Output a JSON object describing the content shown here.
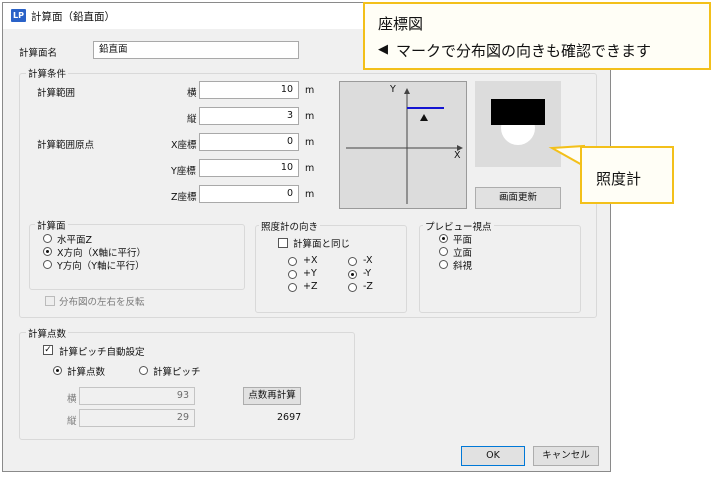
{
  "dialog": {
    "title": "計算面（鉛直面）",
    "app_icon": "LP"
  },
  "plane_name": {
    "label": "計算面名",
    "value": "鉛直面"
  },
  "calc_conditions": {
    "title": "計算条件",
    "range_label": "計算範囲",
    "width_label": "横",
    "width_value": "10",
    "width_unit": "m",
    "height_label": "縦",
    "height_value": "3",
    "height_unit": "m",
    "origin_label": "計算範囲原点",
    "x_label": "X座標",
    "x_value": "0",
    "x_unit": "m",
    "y_label": "Y座標",
    "y_value": "10",
    "y_unit": "m",
    "z_label": "Z座標",
    "z_value": "0",
    "z_unit": "m"
  },
  "coord_diagram": {
    "y_axis": "Y",
    "x_axis": "X"
  },
  "refresh_button": "画面更新",
  "plane_group": {
    "title": "計算面",
    "options": [
      "水平面Z",
      "X方向（X軸に平行）",
      "Y方向（Y軸に平行）"
    ],
    "selected_index": 1
  },
  "flip_checkbox": {
    "label": "分布図の左右を反転",
    "checked": false,
    "disabled": true
  },
  "meter_direction": {
    "title": "照度計の向き",
    "same_label": "計算面と同じ",
    "same_checked": false,
    "options_left": [
      "+X",
      "+Y",
      "+Z"
    ],
    "options_right": [
      "-X",
      "-Y",
      "-Z"
    ],
    "selected": "-Y"
  },
  "preview_view": {
    "title": "プレビュー視点",
    "options": [
      "平面",
      "立面",
      "斜視"
    ],
    "selected_index": 0
  },
  "points": {
    "title": "計算点数",
    "auto_pitch_label": "計算ピッチ自動設定",
    "auto_pitch_checked": true,
    "radio_count_label": "計算点数",
    "radio_pitch_label": "計算ピッチ",
    "selected": "count",
    "width_label": "横",
    "width_value": "93",
    "height_label": "縦",
    "height_value": "29",
    "recalc_button": "点数再計算",
    "total": "2697"
  },
  "buttons": {
    "ok": "OK",
    "cancel": "キャンセル"
  },
  "callouts": {
    "coord_title": "座標図",
    "coord_text": "マークで分布図の向きも確認できます",
    "meter": "照度計"
  },
  "colors": {
    "callout_border": "#f3c01a",
    "axis_marker": "#1414d2",
    "focus_border": "#0078d7"
  }
}
